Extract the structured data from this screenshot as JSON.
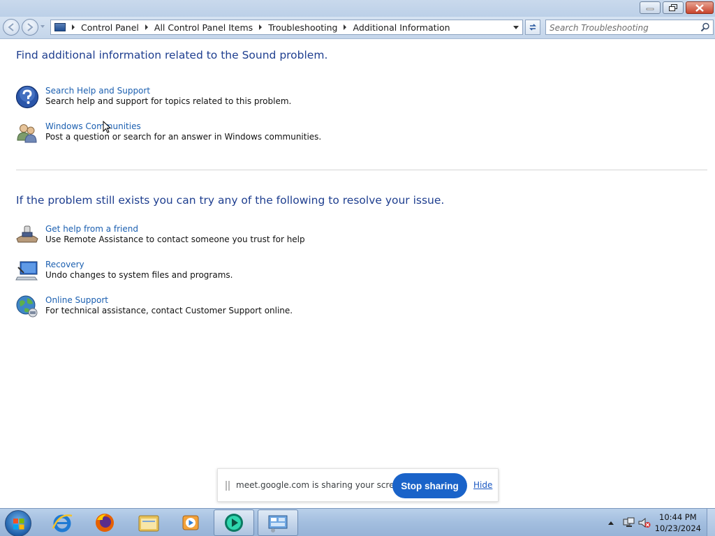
{
  "window": {
    "breadcrumb": [
      "Control Panel",
      "All Control Panel Items",
      "Troubleshooting",
      "Additional Information"
    ],
    "search": {
      "placeholder": "Search Troubleshooting"
    }
  },
  "content": {
    "heading1": "Find additional information related to the Sound problem.",
    "items1": [
      {
        "link": "Search Help and Support",
        "desc": "Search help and support for topics related to this problem.",
        "icon": "help-icon"
      },
      {
        "link": "Windows Communities",
        "desc": "Post a question or search for an answer in Windows communities.",
        "icon": "users-icon"
      }
    ],
    "heading2": "If the problem still exists you can try any of the following to resolve your issue.",
    "items2": [
      {
        "link": "Get help from a friend",
        "desc": "Use Remote Assistance to contact someone you trust for help",
        "icon": "remote-assistance-icon"
      },
      {
        "link": "Recovery",
        "desc": "Undo changes to system files and programs.",
        "icon": "recovery-icon"
      },
      {
        "link": "Online Support",
        "desc": "For technical assistance, contact Customer Support online.",
        "icon": "globe-icon"
      }
    ]
  },
  "sharebar": {
    "message": "meet.google.com is sharing your screen.",
    "stop_label": "Stop sharing",
    "hide_label": "Hide"
  },
  "taskbar": {
    "time": "10:44 PM",
    "date": "10/23/2024",
    "apps": [
      "internet-explorer-icon",
      "firefox-icon",
      "file-explorer-icon",
      "media-player-icon",
      "meet-app-icon",
      "control-panel-icon"
    ]
  },
  "colors": {
    "heading": "#1e3e8f",
    "link": "#1b5fb0",
    "stop_button": "#1a63c9"
  }
}
